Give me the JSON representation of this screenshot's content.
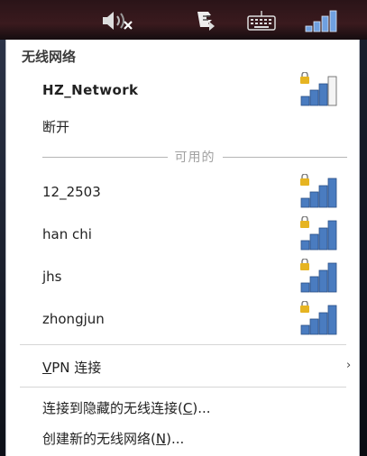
{
  "menu": {
    "header": "无线网络",
    "current_network": {
      "name": "HZ_Network",
      "signal_bars": 3,
      "locked": true
    },
    "disconnect_label": "断开",
    "available_label": "可用的",
    "networks": [
      {
        "name": "12_2503",
        "signal_bars": 4,
        "locked": true
      },
      {
        "name": "han chi",
        "signal_bars": 4,
        "locked": true
      },
      {
        "name": "jhs",
        "signal_bars": 4,
        "locked": true
      },
      {
        "name": "zhongjun",
        "signal_bars": 4,
        "locked": true
      }
    ],
    "vpn": {
      "label_pre": "",
      "label_mnemonic": "V",
      "label_post": "PN 连接",
      "arrow": "›"
    },
    "connect_hidden": {
      "label_pre": "连接到隐藏的无线连接(",
      "label_mnemonic": "C",
      "label_post": ")..."
    },
    "create_new": {
      "label_pre": "创建新的无线网络(",
      "label_mnemonic": "N",
      "label_post": ")..."
    }
  },
  "tray": {
    "icons": [
      "volume-muted-icon",
      "clipboard-icon",
      "keyboard-icon",
      "network-signal-icon"
    ]
  },
  "colors": {
    "signal_fill": "#4a7cc0",
    "signal_empty": "#f4f4f4",
    "lock": "#e6b422"
  }
}
